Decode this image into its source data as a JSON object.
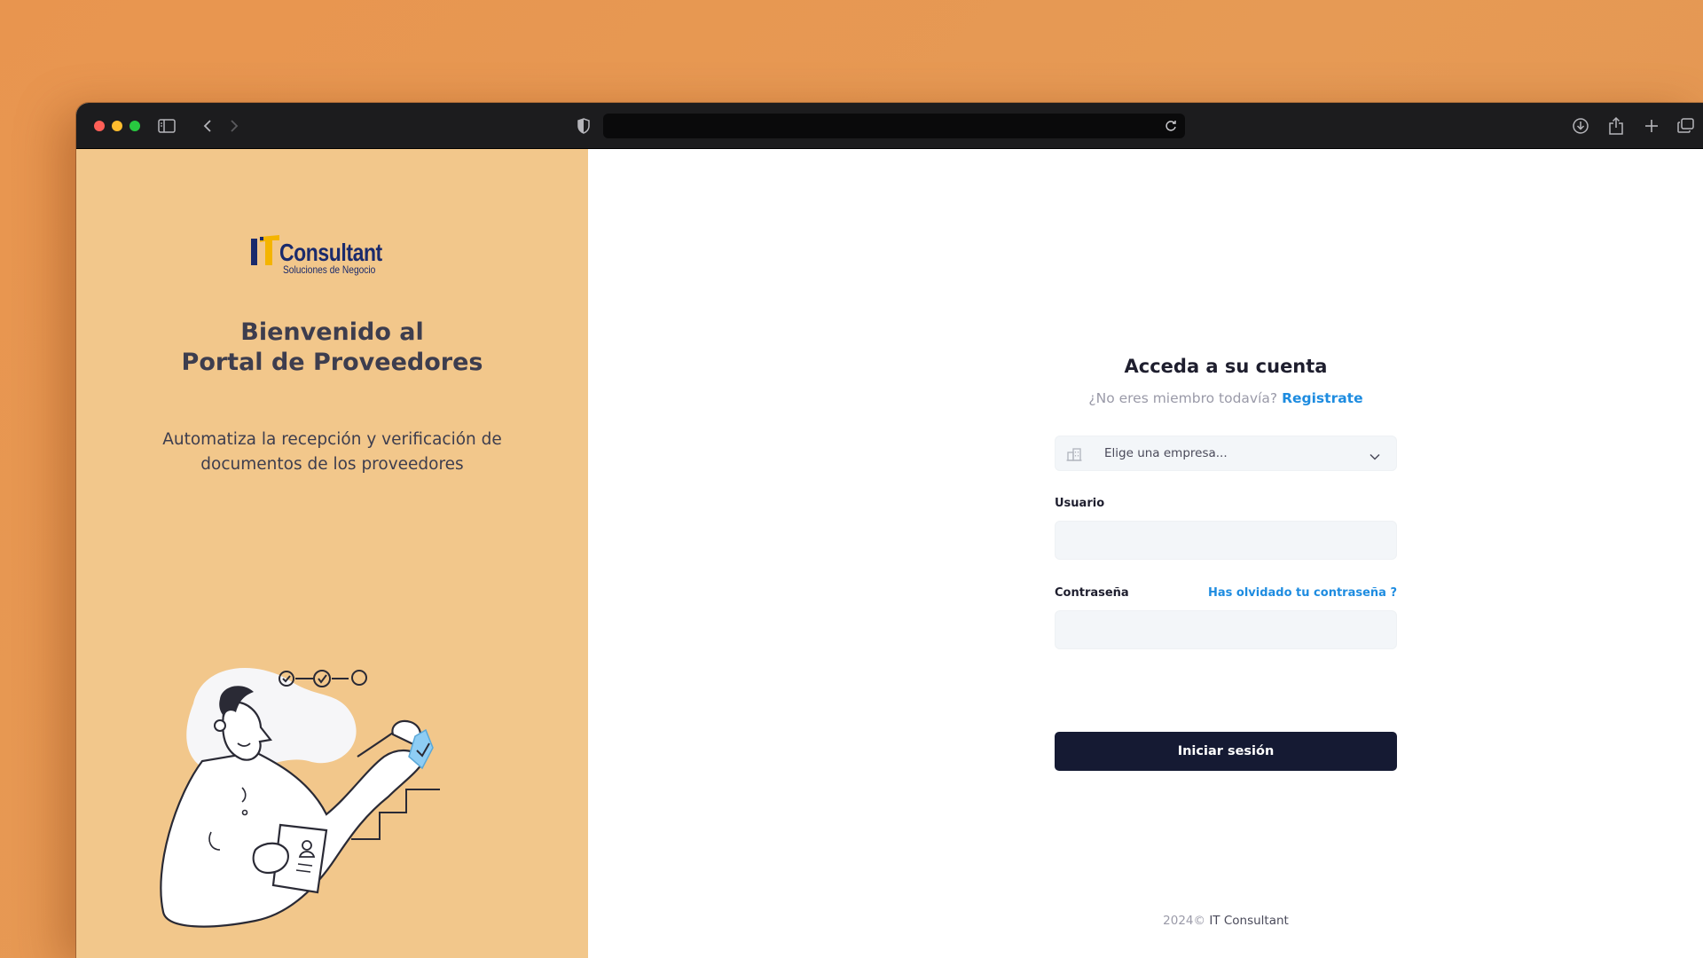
{
  "browser": {
    "url": "",
    "icons": [
      "sidebar-icon",
      "back-icon",
      "forward-icon",
      "shield-icon",
      "reload-icon",
      "download-icon",
      "share-icon",
      "new-tab-icon",
      "tabs-overview-icon"
    ]
  },
  "left_panel": {
    "logo_brand": "Consultant",
    "logo_sub": "Soluciones de Negocio",
    "welcome_line1": "Bienvenido al",
    "welcome_line2": "Portal de Proveedores",
    "tagline_line1": "Automatiza la recepción y verificación de",
    "tagline_line2": "documentos de los proveedores",
    "background_color": "#f2c78b"
  },
  "login": {
    "title": "Acceda a su cuenta",
    "not_member_text": "¿No eres miembro todavía?",
    "register_link": "Registrate",
    "company_select_placeholder": "Elige una empresa...",
    "user_label": "Usuario",
    "user_value": "",
    "password_label": "Contraseña",
    "password_value": "",
    "forgot_link": "Has olvidado tu contraseña ?",
    "submit_label": "Iniciar sesión",
    "accent_color": "#1e8ce0",
    "button_color": "#151a33"
  },
  "footer": {
    "year": "2024©",
    "company": "IT Consultant"
  }
}
